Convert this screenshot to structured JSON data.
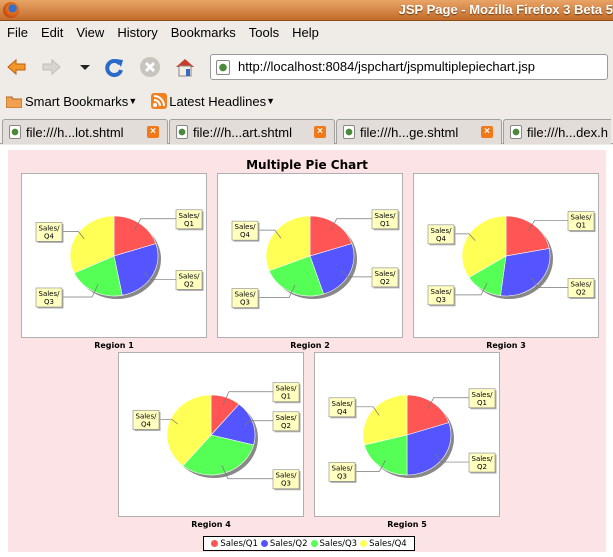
{
  "window": {
    "title": "JSP Page - Mozilla Firefox 3 Beta 5"
  },
  "menu": [
    "File",
    "Edit",
    "View",
    "History",
    "Bookmarks",
    "Tools",
    "Help"
  ],
  "toolbar": {
    "url": "http://localhost:8084/jspchart/jspmultiplepiechart.jsp"
  },
  "bookmarks": [
    "Smart Bookmarks",
    "Latest Headlines"
  ],
  "tabs": [
    {
      "label": "file:///h...lot.shtml"
    },
    {
      "label": "file:///h...art.shtml"
    },
    {
      "label": "file:///h...ge.shtml"
    },
    {
      "label": "file:///h...dex.h"
    }
  ],
  "chart_data": {
    "type": "pie",
    "title": "Multiple Pie Chart",
    "categories": [
      "Sales/Q1",
      "Sales/Q2",
      "Sales/Q3",
      "Sales/Q4"
    ],
    "colors": [
      "#ff5555",
      "#5555ff",
      "#55ff55",
      "#ffff55"
    ],
    "legend_placement": "bottom",
    "charts": [
      {
        "name": "Region 1",
        "values": [
          20,
          27,
          21,
          32
        ]
      },
      {
        "name": "Region 2",
        "values": [
          20,
          25,
          24,
          31
        ]
      },
      {
        "name": "Region 3",
        "values": [
          22,
          30,
          14,
          34
        ]
      },
      {
        "name": "Region 4",
        "values": [
          11,
          18,
          32,
          39
        ]
      },
      {
        "name": "Region 5",
        "values": [
          20,
          30,
          21,
          29
        ]
      }
    ]
  }
}
